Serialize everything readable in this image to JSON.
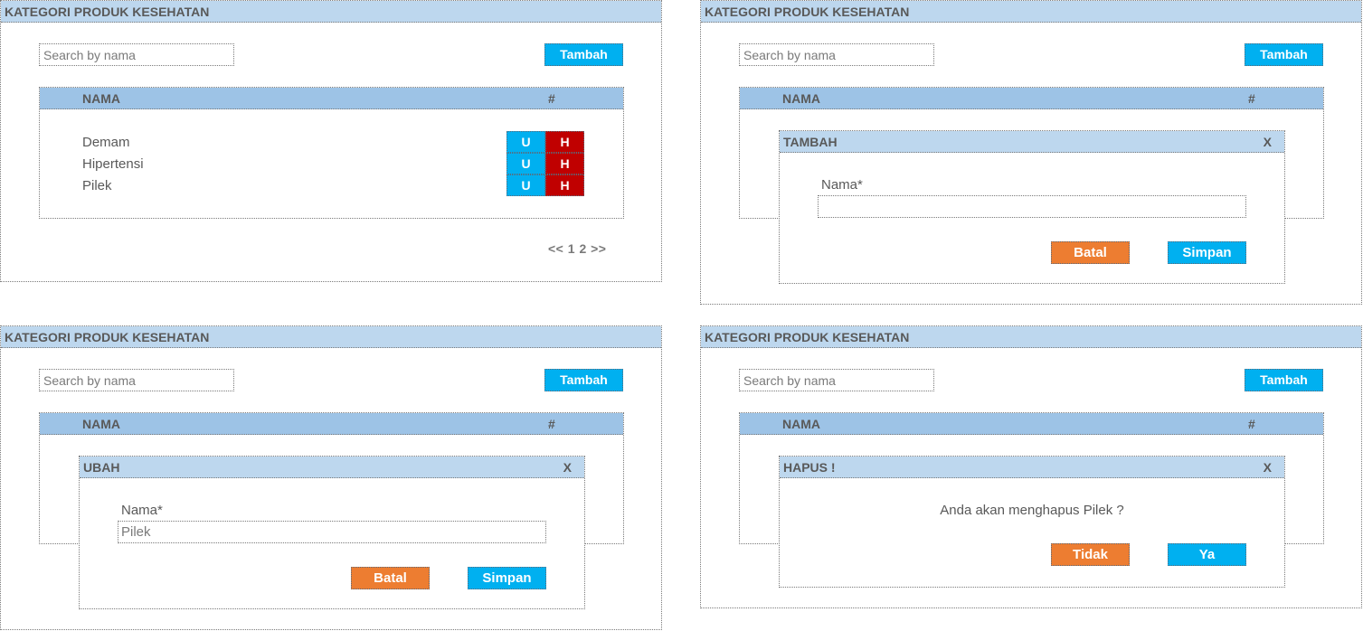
{
  "panels": [
    {
      "title": "KATEGORI PRODUK KESEHATAN",
      "search_placeholder": "Search by nama",
      "add_label": "Tambah",
      "col_nama": "NAMA",
      "col_hash": "#",
      "rows": [
        {
          "nama": "Demam",
          "edit": "U",
          "delete": "H"
        },
        {
          "nama": "Hipertensi",
          "edit": "U",
          "delete": "H"
        },
        {
          "nama": "Pilek",
          "edit": "U",
          "delete": "H"
        }
      ],
      "pagination": {
        "prev": "<<",
        "pages": [
          "1",
          "2"
        ],
        "next": ">>"
      }
    },
    {
      "title": "KATEGORI PRODUK KESEHATAN",
      "search_placeholder": "Search by nama",
      "add_label": "Tambah",
      "col_nama": "NAMA",
      "col_hash": "#",
      "modal": {
        "title": "TAMBAH",
        "close": "X",
        "field_label": "Nama*",
        "field_value": "",
        "cancel_label": "Batal",
        "save_label": "Simpan"
      }
    },
    {
      "title": "KATEGORI PRODUK KESEHATAN",
      "search_placeholder": "Search by nama",
      "add_label": "Tambah",
      "col_nama": "NAMA",
      "col_hash": "#",
      "modal": {
        "title": "UBAH",
        "close": "X",
        "field_label": "Nama*",
        "field_value": "Pilek",
        "cancel_label": "Batal",
        "save_label": "Simpan"
      }
    },
    {
      "title": "KATEGORI PRODUK KESEHATAN",
      "search_placeholder": "Search by nama",
      "add_label": "Tambah",
      "col_nama": "NAMA",
      "col_hash": "#",
      "modal": {
        "title": "HAPUS !",
        "close": "X",
        "message": "Anda akan menghapus Pilek ?",
        "no_label": "Tidak",
        "yes_label": "Ya"
      }
    }
  ],
  "colors": {
    "title_bar": "#bdd7ee",
    "table_header": "#9dc3e6",
    "primary_button": "#00b0f0",
    "danger_button": "#c00000",
    "cancel_button": "#ed7d31",
    "text": "#595959"
  }
}
